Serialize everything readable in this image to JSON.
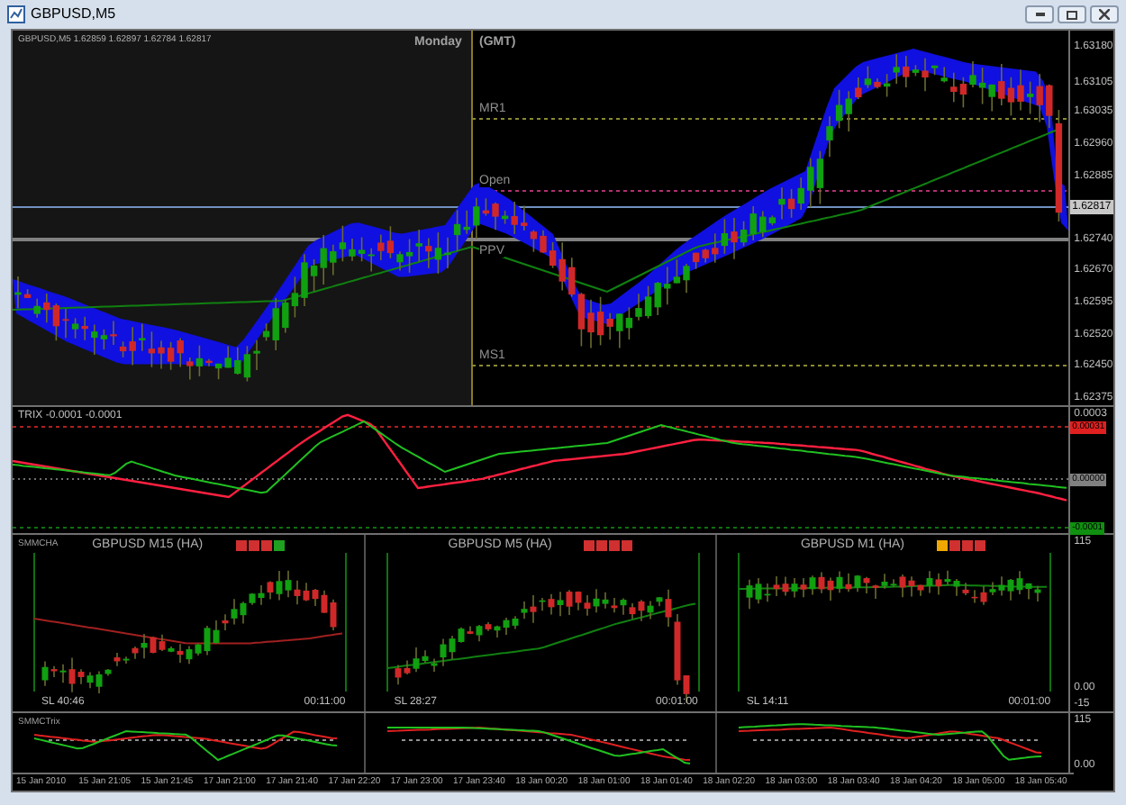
{
  "window": {
    "title": "GBPUSD,M5"
  },
  "main_chart": {
    "legend": "GBPUSD,M5  1.62859 1.62897 1.62784 1.62817",
    "day_label": "Monday",
    "timezone_label": "(GMT)",
    "levels": [
      {
        "label": "MR1",
        "kind": "resistance"
      },
      {
        "label": "Open",
        "kind": "open"
      },
      {
        "label": "PPV",
        "kind": "pivot"
      },
      {
        "label": "MS1",
        "kind": "support"
      }
    ],
    "price_axis": [
      "1.63180",
      "1.63105",
      "1.63035",
      "1.62960",
      "1.62885",
      "1.62740",
      "1.62670",
      "1.62595",
      "1.62520",
      "1.62450",
      "1.62375"
    ],
    "current_price": "1.62817"
  },
  "trix_pane": {
    "legend": "TRIX -0.0001 -0.0001",
    "axis": [
      "0.0003"
    ],
    "badges": [
      {
        "text": "0.00031",
        "color": "#e02020"
      },
      {
        "text": "0.00000",
        "color": "#808080"
      },
      {
        "text": "-0.0001",
        "color": "#109010"
      }
    ]
  },
  "smmcha_pane": {
    "legend": "SMMCHA",
    "axis": [
      "115",
      "0.00",
      "-15"
    ],
    "panels": [
      {
        "title": "GBPUSD M15 (HA)",
        "signals": [
          {
            "color": "#d03030"
          },
          {
            "color": "#d03030"
          },
          {
            "color": "#d03030"
          },
          {
            "color": "#20a020"
          }
        ],
        "stop_loss": "SL 40:46",
        "timer": "00:11:00"
      },
      {
        "title": "GBPUSD M5 (HA)",
        "signals": [
          {
            "color": "#d03030"
          },
          {
            "color": "#d03030"
          },
          {
            "color": "#d03030"
          },
          {
            "color": "#d03030"
          }
        ],
        "stop_loss": "SL 28:27",
        "timer": "00:01:00"
      },
      {
        "title": "GBPUSD M1 (HA)",
        "signals": [
          {
            "color": "#f0a800"
          },
          {
            "color": "#d03030"
          },
          {
            "color": "#d03030"
          },
          {
            "color": "#d03030"
          }
        ],
        "stop_loss": "SL 14:11",
        "timer": "00:01:00"
      }
    ]
  },
  "smmctrix_pane": {
    "legend": "SMMCTrix",
    "axis": [
      "115",
      "0.00"
    ]
  },
  "time_axis": [
    "15 Jan 2010",
    "15 Jan 21:05",
    "15 Jan 21:45",
    "17 Jan 21:00",
    "17 Jan 21:40",
    "17 Jan 22:20",
    "17 Jan 23:00",
    "17 Jan 23:40",
    "18 Jan 00:20",
    "18 Jan 01:00",
    "18 Jan 01:40",
    "18 Jan 02:20",
    "18 Jan 03:00",
    "18 Jan 03:40",
    "18 Jan 04:20",
    "18 Jan 05:00",
    "18 Jan 05:40"
  ]
}
